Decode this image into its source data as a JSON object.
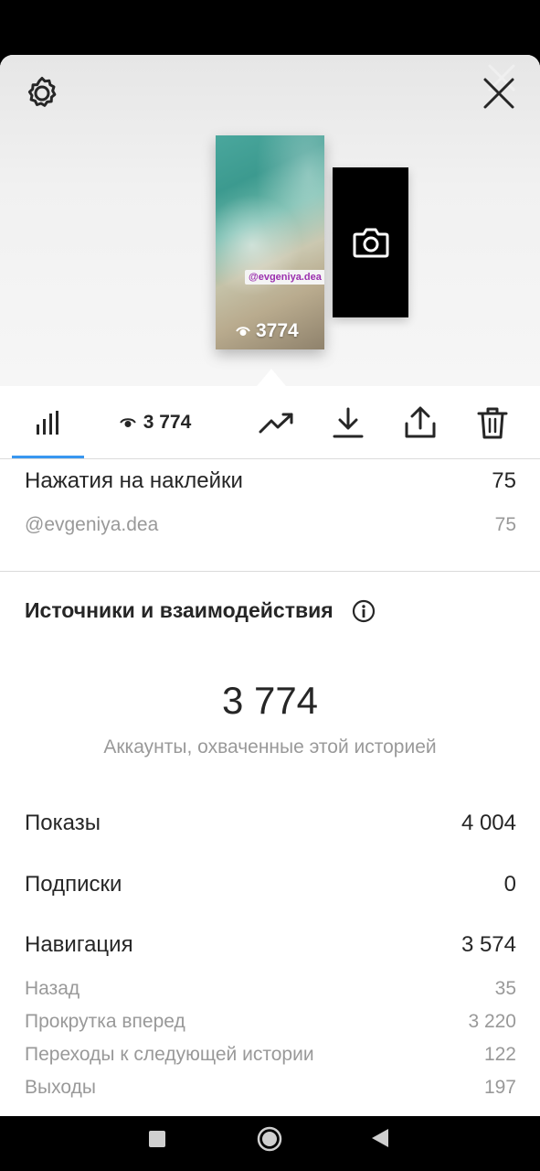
{
  "preview": {
    "mention_tag": "@evgeniya.dea",
    "thumb_views": "3774"
  },
  "toolbar": {
    "views_count": "3 774",
    "active_tab_color": "#3897f0"
  },
  "sticker_taps": {
    "label": "Нажатия на наклейки",
    "value": "75",
    "items": [
      {
        "label": "@evgeniya.dea",
        "value": "75"
      }
    ]
  },
  "sources": {
    "title": "Источники и взаимодействия",
    "reach_number": "3 774",
    "reach_caption": "Аккаунты, охваченные этой историей",
    "rows": [
      {
        "label": "Показы",
        "value": "4 004"
      },
      {
        "label": "Подписки",
        "value": "0"
      },
      {
        "label": "Навигация",
        "value": "3 574"
      }
    ],
    "navigation_items": [
      {
        "label": "Назад",
        "value": "35"
      },
      {
        "label": "Прокрутка вперед",
        "value": "3 220"
      },
      {
        "label": "Переходы к следующей истории",
        "value": "122"
      },
      {
        "label": "Выходы",
        "value": "197"
      }
    ]
  },
  "icons": [
    "gear-icon",
    "close-icon",
    "camera-icon",
    "eye-icon",
    "bar-chart-icon",
    "trending-icon",
    "download-icon",
    "share-icon",
    "trash-icon",
    "info-icon",
    "nav-square-icon",
    "nav-home-icon",
    "nav-back-icon"
  ]
}
